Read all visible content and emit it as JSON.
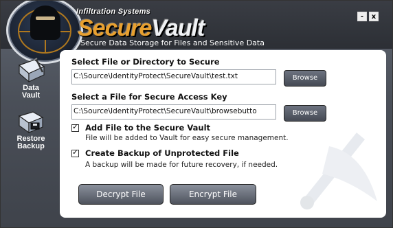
{
  "window": {
    "brand": "Infiltration Systems",
    "title_part1": "Secure",
    "title_part2": "Vault",
    "tagline": "Secure Data Storage for Files and Sensitive Data",
    "minimize_glyph": "-",
    "close_glyph": "x"
  },
  "sidebar": {
    "items": [
      {
        "label_line1": "Data",
        "label_line2": "Vault",
        "icon": "data-vault-icon"
      },
      {
        "label_line1": "Restore",
        "label_line2": "Backup",
        "icon": "restore-backup-icon"
      }
    ]
  },
  "form": {
    "source_label": "Select File or Directory to Secure",
    "source_value": "C:\\Source\\IdentityProtect\\SecureVault\\test.txt",
    "key_label": "Select a File for Secure Access Key",
    "key_value": "C:\\Source\\IdentityProtect\\SecureVault\\browsebutto",
    "browse_label": "Browse",
    "add_file": {
      "label": "Add File to the Secure Vault",
      "description": "File will be added to Vault for easy secure management.",
      "checked": true
    },
    "backup": {
      "label": "Create Backup of Unprotected File",
      "description": "A backup will be made for future recovery, if needed.",
      "checked": true
    },
    "decrypt_label": "Decrypt File",
    "encrypt_label": "Encrypt File"
  },
  "colors": {
    "accent": "#e8a030",
    "chrome": "#4a4f58",
    "panel": "#ffffff"
  }
}
